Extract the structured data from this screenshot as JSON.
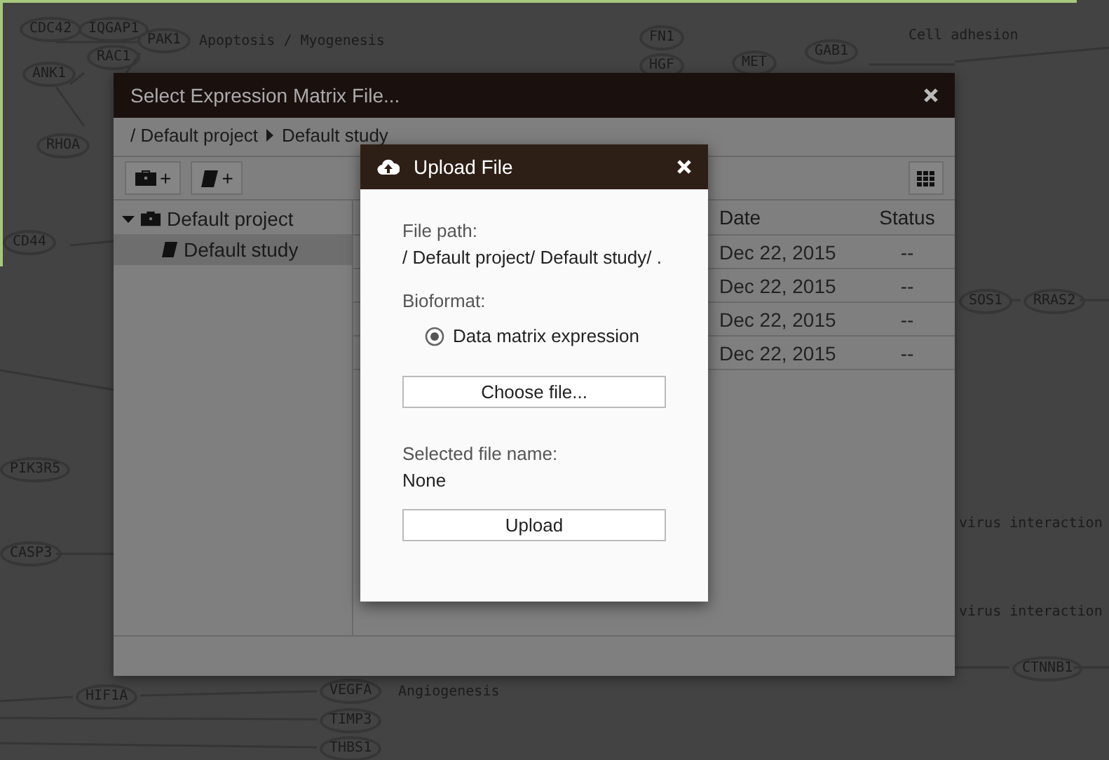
{
  "background_diagram": {
    "genes": [
      {
        "label": "CDC42"
      },
      {
        "label": "IQGAP1"
      },
      {
        "label": "PAK1"
      },
      {
        "label": "ANK1"
      },
      {
        "label": "RAC1"
      },
      {
        "label": "RHOA"
      },
      {
        "label": "CD44"
      },
      {
        "label": "PIK3R5"
      },
      {
        "label": "CASP3"
      },
      {
        "label": "HIF1A"
      },
      {
        "label": "VEGFA"
      },
      {
        "label": "TIMP3"
      },
      {
        "label": "THBS1"
      },
      {
        "label": "FN1"
      },
      {
        "label": "HGF"
      },
      {
        "label": "MET"
      },
      {
        "label": "GAB1"
      },
      {
        "label": "SOS1"
      },
      {
        "label": "RRAS2"
      },
      {
        "label": "CTNNB1"
      }
    ],
    "pathways": [
      {
        "label": "Apoptosis / Myogenesis"
      },
      {
        "label": "Cell adhesion"
      },
      {
        "label": "virus interaction"
      },
      {
        "label": "virus interaction"
      },
      {
        "label": "Angiogenesis"
      }
    ]
  },
  "dialog": {
    "title": "Select Expression Matrix File...",
    "breadcrumb": [
      {
        "label": "/ Default project"
      },
      {
        "label": "Default study"
      }
    ],
    "toolbar": [
      {
        "kind": "project",
        "label": "+"
      },
      {
        "kind": "study",
        "label": "+"
      }
    ],
    "tree": [
      {
        "label": "Default project",
        "kind": "project",
        "expanded": true,
        "selected": false,
        "children": [
          {
            "label": "Default study",
            "kind": "study",
            "selected": true
          }
        ]
      }
    ],
    "table": {
      "columns": [
        "Date",
        "Status"
      ],
      "rows": [
        [
          "Dec 22, 2015",
          "--"
        ],
        [
          "Dec 22, 2015",
          "--"
        ],
        [
          "Dec 22, 2015",
          "--"
        ],
        [
          "Dec 22, 2015",
          "--"
        ]
      ]
    }
  },
  "upload_dialog": {
    "title": "Upload File",
    "file_path": {
      "label": "File path:",
      "value": "/ Default project/ Default study/ ."
    },
    "bioformat": {
      "label": "Bioformat:",
      "options": [
        {
          "label": "Data matrix expression",
          "selected": true
        }
      ]
    },
    "choose_button": "Choose file...",
    "selected_file": {
      "label": "Selected file name:",
      "value": "None"
    },
    "upload_button": "Upload"
  }
}
